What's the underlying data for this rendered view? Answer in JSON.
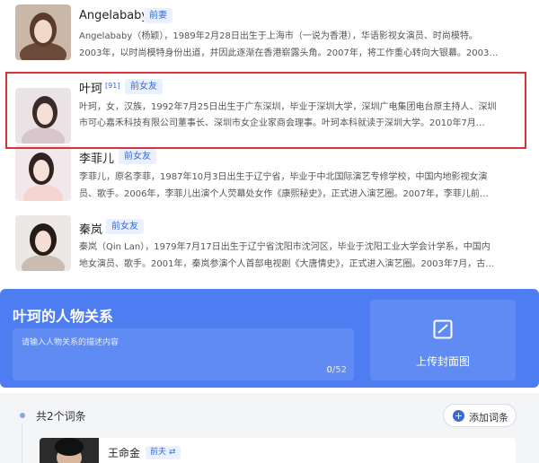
{
  "people": [
    {
      "name": "Angelababy",
      "sup": "",
      "tag": "前妻",
      "desc1": "Angelababy（杨颖），1989年2月28日出生于上海市（一说为香港），华语影视女演员、时尚模特。",
      "desc2": "2003年，以时尚模特身份出道，并因此逐渐在香港崭露头角。2007年，将工作重心转向大银幕。2003…"
    },
    {
      "name": "叶珂",
      "sup": "[91]",
      "tag": "前女友",
      "desc1": "叶珂，女，汉族，1992年7月25日出生于广东深圳，毕业于深圳大学，深圳广电集团电台原主持人、深圳",
      "desc2": "市可心嘉禾科技有限公司董事长、深圳市女企业家商会理事。叶珂本科就读于深圳大学。2010年7月…"
    },
    {
      "name": "李菲儿",
      "sup": "",
      "tag": "前女友",
      "desc1": "李菲儿，原名李菲，1987年10月3日出生于辽宁省，毕业于中北国际演艺专修学校，中国内地影视女演",
      "desc2": "员、歌手。2006年，李菲儿出演个人荧幕处女作《康熙秘史》，正式进入演艺圈。2007年，李菲儿前…"
    },
    {
      "name": "秦岚",
      "sup": "",
      "tag": "前女友",
      "desc1": "秦岚（Qin Lan），1979年7月17日出生于辽宁省沈阳市沈河区，毕业于沈阳工业大学会计学系，中国内",
      "desc2": "地女演员、歌手。2001年，秦岚参演个人首部电视剧《大唐情史》，正式进入演艺圈。2003年7月，古…"
    }
  ],
  "relation": {
    "title": "叶珂的人物关系",
    "placeholder": "请输入人物关系的描述内容",
    "count_current": "0",
    "count_max": "/52",
    "upload_label": "上传封面图"
  },
  "entries": {
    "count_label": "共2个词条",
    "add_label": "添加词条",
    "items": [
      {
        "name": "王命金",
        "tag": "前夫"
      }
    ]
  },
  "colors": {
    "accent": "#4d7df1",
    "tag_text": "#3a6ad9",
    "highlight": "#d9333c"
  }
}
